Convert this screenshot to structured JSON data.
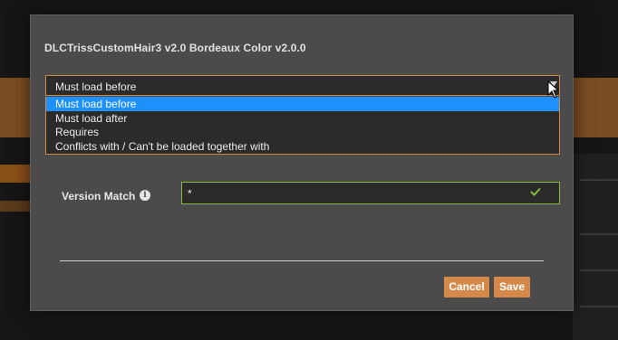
{
  "modal": {
    "title": "DLCTrissCustomHair3 v2.0 Bordeaux Color v2.0.0"
  },
  "rule_select": {
    "selected_value": "Must load before",
    "options": [
      "Must load before",
      "Must load after",
      "Requires",
      "Conflicts with / Can't be loaded together with"
    ],
    "highlighted_index": 0
  },
  "version_match": {
    "label": "Version Match",
    "value": "*",
    "info_icon": "info-icon",
    "valid_icon": "check-icon"
  },
  "buttons": {
    "cancel_label": "Cancel",
    "save_label": "Save"
  },
  "colors": {
    "accent": "#d4894a",
    "selection": "#1e90ff",
    "valid": "#8bbb3b",
    "modal_bg": "#4b4b4b",
    "field_bg": "#2b2b2b"
  }
}
